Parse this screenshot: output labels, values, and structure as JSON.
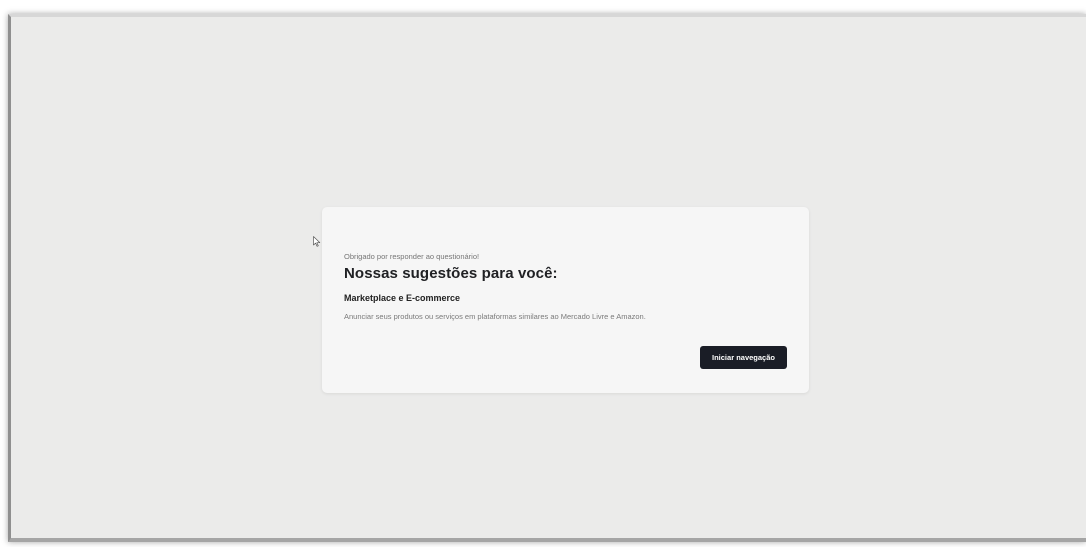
{
  "survey_result": {
    "thanks_message": "Obrigado por responder ao questionário!",
    "title": "Nossas sugestões para você:",
    "suggestion": {
      "title": "Marketplace e E-commerce",
      "description": "Anunciar seus produtos ou serviços em plataformas similares ao Mercado Livre e Amazon."
    },
    "start_button_label": "Iniciar navegação"
  },
  "colors": {
    "background": "#ebebea",
    "card": "#f6f6f6",
    "button": "#1a1d26"
  },
  "icons": {
    "cursor": "mouse-pointer-icon"
  }
}
